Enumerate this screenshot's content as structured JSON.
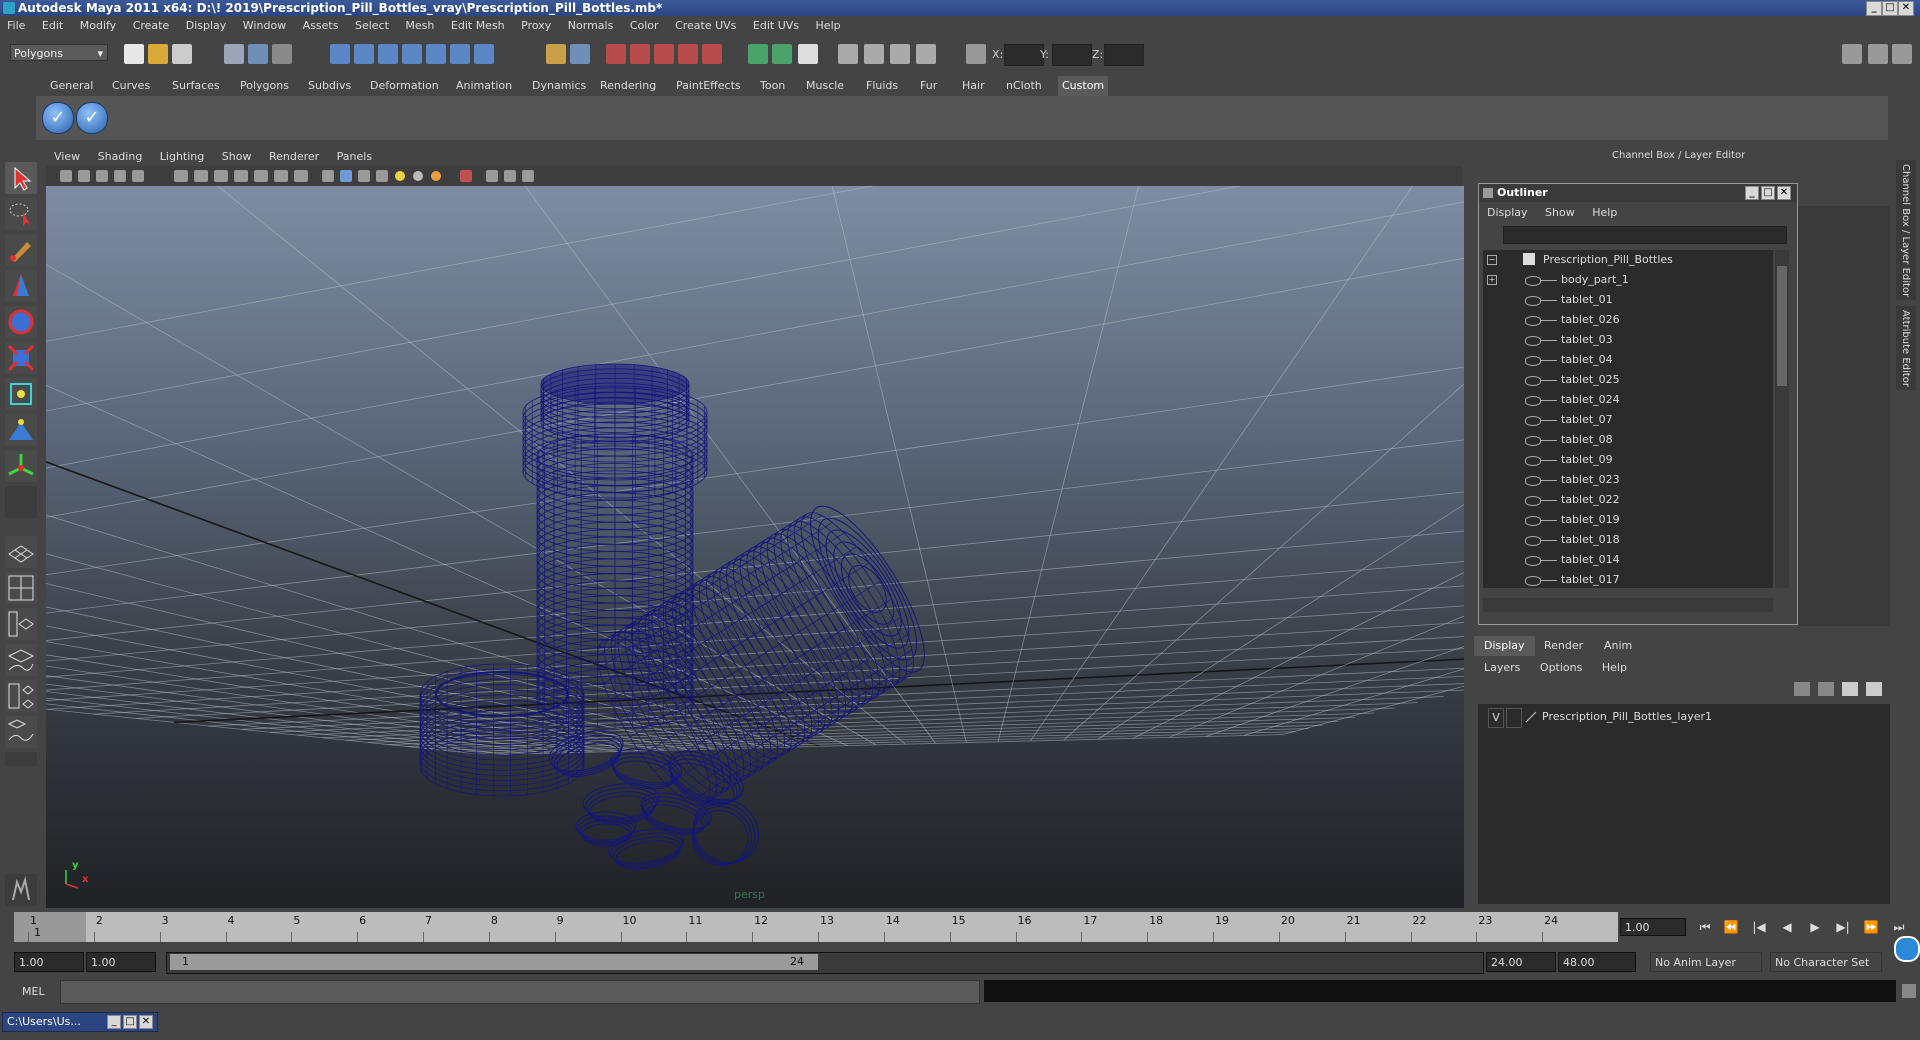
{
  "window": {
    "title": "Autodesk Maya 2011 x64: D:\\! 2019\\Prescription_Pill_Bottles_vray\\Prescription_Pill_Bottles.mb*",
    "minimize_glyph": "_",
    "maximize_glyph": "□",
    "close_glyph": "✕"
  },
  "menubar": [
    "File",
    "Edit",
    "Modify",
    "Create",
    "Display",
    "Window",
    "Assets",
    "Select",
    "Mesh",
    "Edit Mesh",
    "Proxy",
    "Normals",
    "Color",
    "Create UVs",
    "Edit UVs",
    "Help"
  ],
  "statusline": {
    "mode": "Polygons",
    "x_label": "X:",
    "y_label": "Y:",
    "z_label": "Z:"
  },
  "shelf": {
    "tabs": [
      "General",
      "Curves",
      "Surfaces",
      "Polygons",
      "Subdivs",
      "Deformation",
      "Animation",
      "Dynamics",
      "Rendering",
      "PaintEffects",
      "Toon",
      "Muscle",
      "Fluids",
      "Fur",
      "Hair",
      "nCloth",
      "Custom"
    ],
    "active_tab": "Custom",
    "icon_glyph": "✓"
  },
  "viewport": {
    "menu": [
      "View",
      "Shading",
      "Lighting",
      "Show",
      "Renderer",
      "Panels"
    ],
    "camera_label": "persp",
    "axis_x": "x",
    "axis_y": "y",
    "grid_color": "#b8c2cc",
    "wire_color": "#15167a"
  },
  "channel_box": {
    "title": "Channel Box / Layer Editor",
    "side_tab_1": "Channel Box / Layer Editor",
    "side_tab_2": "Attribute Editor"
  },
  "outliner": {
    "title": "Outliner",
    "menu": [
      "Display",
      "Show",
      "Help"
    ],
    "items": [
      {
        "label": "Prescription_Pill_Bottles",
        "depth": 0
      },
      {
        "label": "body_part_1",
        "depth": 1
      },
      {
        "label": "tablet_01",
        "depth": 1
      },
      {
        "label": "tablet_026",
        "depth": 1
      },
      {
        "label": "tablet_03",
        "depth": 1
      },
      {
        "label": "tablet_04",
        "depth": 1
      },
      {
        "label": "tablet_025",
        "depth": 1
      },
      {
        "label": "tablet_024",
        "depth": 1
      },
      {
        "label": "tablet_07",
        "depth": 1
      },
      {
        "label": "tablet_08",
        "depth": 1
      },
      {
        "label": "tablet_09",
        "depth": 1
      },
      {
        "label": "tablet_023",
        "depth": 1
      },
      {
        "label": "tablet_022",
        "depth": 1
      },
      {
        "label": "tablet_019",
        "depth": 1
      },
      {
        "label": "tablet_018",
        "depth": 1
      },
      {
        "label": "tablet_014",
        "depth": 1
      },
      {
        "label": "tablet_017",
        "depth": 1
      }
    ]
  },
  "layer_editor": {
    "tabs": [
      "Display",
      "Render",
      "Anim"
    ],
    "active_tab": "Display",
    "menu": [
      "Layers",
      "Options",
      "Help"
    ],
    "layers": [
      {
        "visible": "V",
        "name": "Prescription_Pill_Bottles_layer1"
      }
    ]
  },
  "timeline": {
    "ticks": [
      "1",
      "2",
      "3",
      "4",
      "5",
      "6",
      "7",
      "8",
      "9",
      "10",
      "11",
      "12",
      "13",
      "14",
      "15",
      "16",
      "17",
      "18",
      "19",
      "20",
      "21",
      "22",
      "23",
      "24"
    ],
    "current_frame_marker": "1",
    "current_frame": "1.00",
    "playback": [
      "⏮",
      "⏪",
      "|◀",
      "◀",
      "▶",
      "▶|",
      "⏩",
      "⏭"
    ]
  },
  "range": {
    "start": "1.00",
    "anim_start": "1.00",
    "slider_start": "1",
    "slider_end": "24",
    "anim_end": "24.00",
    "end": "48.00",
    "anim_layer": "No Anim Layer",
    "character_set": "No Character Set"
  },
  "command_line": {
    "label": "MEL"
  },
  "taskbar": {
    "item": "C:\\Users\\Us..."
  }
}
